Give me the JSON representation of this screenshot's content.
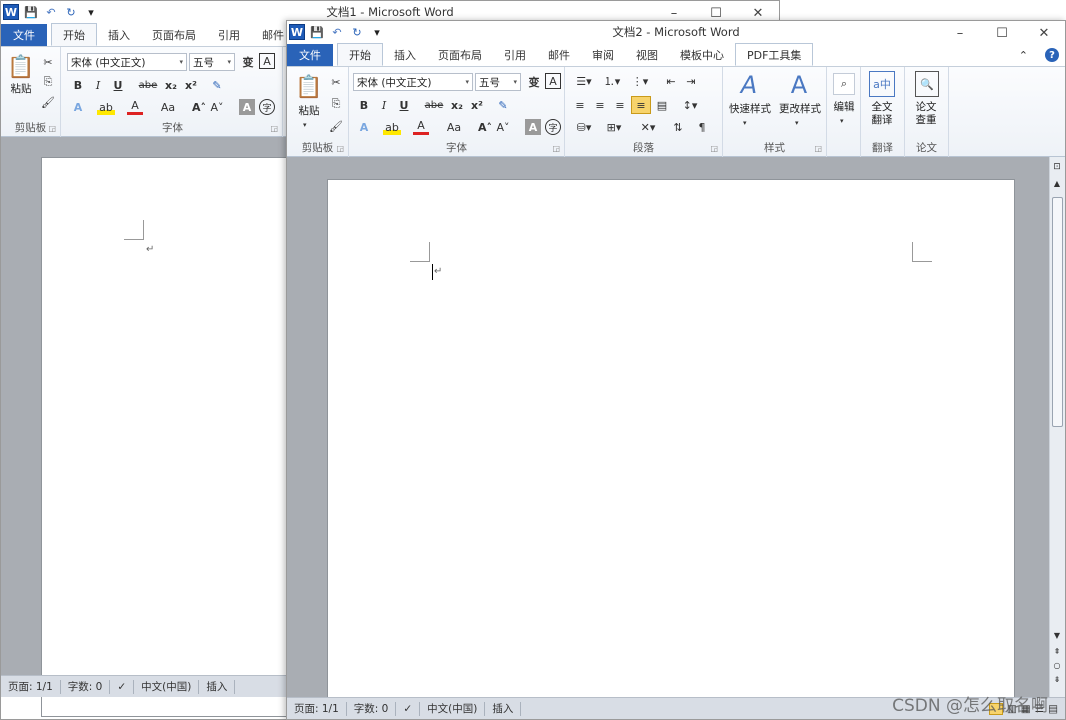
{
  "window1": {
    "title": "文档1 - Microsoft Word",
    "tabs": [
      "文件",
      "开始",
      "插入",
      "页面布局",
      "引用",
      "邮件"
    ],
    "clipboard": {
      "paste": "粘贴",
      "group": "剪贴板"
    },
    "font": {
      "name": "宋体 (中文正文)",
      "size": "五号",
      "group": "字体",
      "bold": "B",
      "italic": "I",
      "underline": "U",
      "strike": "abe",
      "sub": "x₂",
      "sup": "x²",
      "grow": "A˄",
      "shrink": "A˅",
      "case": "Aa"
    },
    "status": {
      "page": "页面: 1/1",
      "words": "字数: 0",
      "lang": "中文(中国)",
      "mode": "插入"
    }
  },
  "window2": {
    "title": "文档2 - Microsoft Word",
    "tabs": [
      "文件",
      "开始",
      "插入",
      "页面布局",
      "引用",
      "邮件",
      "审阅",
      "视图",
      "模板中心",
      "PDF工具集"
    ],
    "clipboard": {
      "paste": "粘贴",
      "group": "剪贴板"
    },
    "font": {
      "name": "宋体 (中文正文)",
      "size": "五号",
      "group": "字体"
    },
    "paragraph": {
      "group": "段落"
    },
    "styles": {
      "quick": "快速样式",
      "change": "更改样式",
      "group": "样式"
    },
    "editing": {
      "label": "编辑"
    },
    "translate": {
      "full": "全文翻译",
      "group": "翻译"
    },
    "paper": {
      "check": "论文查重",
      "group": "论文"
    },
    "status": {
      "page": "页面: 1/1",
      "words": "字数: 0",
      "lang": "中文(中国)",
      "mode": "插入"
    }
  },
  "watermark": "CSDN @怎么取名啊",
  "accent": "#2a63b8"
}
